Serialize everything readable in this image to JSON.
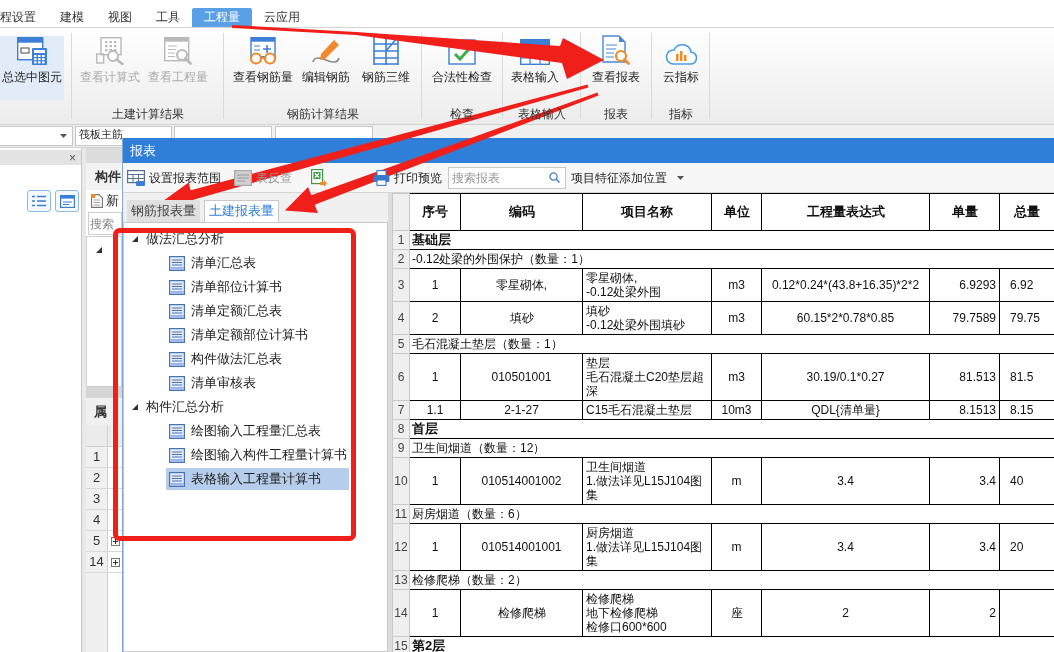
{
  "menu_tabs": [
    {
      "label": "程设置",
      "selected": false
    },
    {
      "label": "建模",
      "selected": false
    },
    {
      "label": "视图",
      "selected": false
    },
    {
      "label": "工具",
      "selected": false
    },
    {
      "label": "工程量",
      "selected": true
    },
    {
      "label": "云应用",
      "selected": false
    }
  ],
  "ribbon": {
    "groups": [
      {
        "buttons": [
          {
            "label": "总选中图元",
            "disabled": false,
            "selected": true
          }
        ]
      },
      {
        "label": "土建计算结果",
        "buttons": [
          {
            "label": "查看计算式",
            "disabled": true,
            "selected": false
          },
          {
            "label": "查看工程量",
            "disabled": true,
            "selected": false
          }
        ]
      },
      {
        "label": "钢筋计算结果",
        "buttons": [
          {
            "label": "查看钢筋量",
            "disabled": false,
            "selected": false
          },
          {
            "label": "编辑钢筋",
            "disabled": false,
            "selected": false
          },
          {
            "label": "钢筋三维",
            "disabled": false,
            "selected": false
          }
        ]
      },
      {
        "label": "检查",
        "buttons": [
          {
            "label": "合法性检查",
            "disabled": false,
            "selected": false
          }
        ]
      },
      {
        "label": "表格输入",
        "buttons": [
          {
            "label": "表格输入",
            "disabled": false,
            "selected": false
          }
        ]
      },
      {
        "label": "报表",
        "buttons": [
          {
            "label": "查看报表",
            "disabled": false,
            "selected": false
          }
        ]
      },
      {
        "label": "指标",
        "buttons": [
          {
            "label": "云指标",
            "disabled": false,
            "selected": false
          }
        ]
      }
    ]
  },
  "property_bar": {
    "dropdowns": [
      {
        "value": "筏板主筋"
      }
    ]
  },
  "side_panel": {
    "close": "×"
  },
  "component_panel": {
    "title": "构件",
    "new_button": "新",
    "search": {
      "placeholder": "搜索"
    }
  },
  "property_panel": {
    "title": "属",
    "rows": [
      {
        "number": "1",
        "expandable": false
      },
      {
        "number": "2",
        "expandable": false
      },
      {
        "number": "3",
        "expandable": false
      },
      {
        "number": "4",
        "expandable": false
      },
      {
        "number": "5",
        "expandable": true
      },
      {
        "number": "14",
        "expandable": true
      }
    ]
  },
  "report_dialog": {
    "title": "报表",
    "toolbar": [
      {
        "label": "设置报表范围",
        "disabled": false
      },
      {
        "label": "表反查",
        "disabled": true
      },
      {
        "disabled": false
      },
      {
        "label": "打印预览",
        "disabled": false
      }
    ],
    "search": {
      "placeholder": "搜索报表"
    },
    "feature_position": "项目特征添加位置",
    "tabs": [
      {
        "label": "钢筋报表量",
        "selected": false
      },
      {
        "label": "土建报表量",
        "selected": true
      }
    ],
    "tree": [
      {
        "label": "做法汇总分析",
        "expanded": true,
        "selected": false,
        "children": [
          {
            "label": "清单汇总表",
            "selected": false
          },
          {
            "label": "清单部位计算书",
            "selected": false
          },
          {
            "label": "清单定额汇总表",
            "selected": false
          },
          {
            "label": "清单定额部位计算书",
            "selected": false
          },
          {
            "label": "构件做法汇总表",
            "selected": false
          },
          {
            "label": "清单审核表",
            "selected": false
          }
        ]
      },
      {
        "label": "构件汇总分析",
        "expanded": true,
        "selected": false,
        "children": [
          {
            "label": "绘图输入工程量汇总表",
            "selected": false
          },
          {
            "label": "绘图输入构件工程量计算书",
            "selected": false
          },
          {
            "label": "表格输入工程量计算书",
            "selected": true
          }
        ]
      }
    ],
    "table": {
      "columns": [
        "序号",
        "编码",
        "项目名称",
        "单位",
        "工程量表达式",
        "单量",
        "总量"
      ],
      "rows": [
        {
          "number": "1",
          "kind": "floor",
          "text": "基础层"
        },
        {
          "number": "2",
          "kind": "group",
          "text": "-0.12处梁的外围保护（数量：1）"
        },
        {
          "number": "3",
          "kind": "item",
          "cells": [
            "1",
            "零星砌体,",
            [
              "零星砌体,",
              "-0.12处梁外围"
            ],
            "m3",
            "0.12*0.24*(43.8+16.35)*2*2",
            "6.9293",
            "6.92"
          ]
        },
        {
          "number": "4",
          "kind": "item",
          "cells": [
            "2",
            "填砂",
            [
              "填砂",
              "-0.12处梁外围填砂"
            ],
            "m3",
            "60.15*2*0.78*0.85",
            "79.7589",
            "79.75"
          ]
        },
        {
          "number": "5",
          "kind": "group",
          "text": "毛石混凝土垫层（数量：1）"
        },
        {
          "number": "6",
          "kind": "item",
          "cells": [
            "1",
            "010501001",
            [
              "垫层",
              "毛石混凝土C20垫层超深"
            ],
            "m3",
            "30.19/0.1*0.27",
            "81.513",
            "81.5"
          ]
        },
        {
          "number": "7",
          "kind": "item",
          "cells": [
            "1.1",
            "2-1-27",
            [
              "C15毛石混凝土垫层"
            ],
            "10m3",
            "QDL{清单量}",
            "8.1513",
            "8.15"
          ]
        },
        {
          "number": "8",
          "kind": "floor",
          "text": "首层"
        },
        {
          "number": "9",
          "kind": "group",
          "text": "卫生间烟道（数量：12）"
        },
        {
          "number": "10",
          "kind": "item",
          "cells": [
            "1",
            "010514001002",
            [
              "卫生间烟道",
              "1.做法详见L15J104图集"
            ],
            "m",
            "3.4",
            "3.4",
            "40"
          ]
        },
        {
          "number": "11",
          "kind": "group",
          "text": "厨房烟道（数量：6）"
        },
        {
          "number": "12",
          "kind": "item",
          "cells": [
            "1",
            "010514001001",
            [
              "厨房烟道",
              "1.做法详见L15J104图集"
            ],
            "m",
            "3.4",
            "3.4",
            "20"
          ]
        },
        {
          "number": "13",
          "kind": "group",
          "text": "检修爬梯（数量：2）"
        },
        {
          "number": "14",
          "kind": "item",
          "cells": [
            "1",
            "检修爬梯",
            [
              "检修爬梯",
              "地下检修爬梯",
              "检修口600*600"
            ],
            "座",
            "2",
            "2"
          ]
        },
        {
          "number": "15",
          "kind": "floor",
          "text": "第2层"
        }
      ]
    }
  }
}
